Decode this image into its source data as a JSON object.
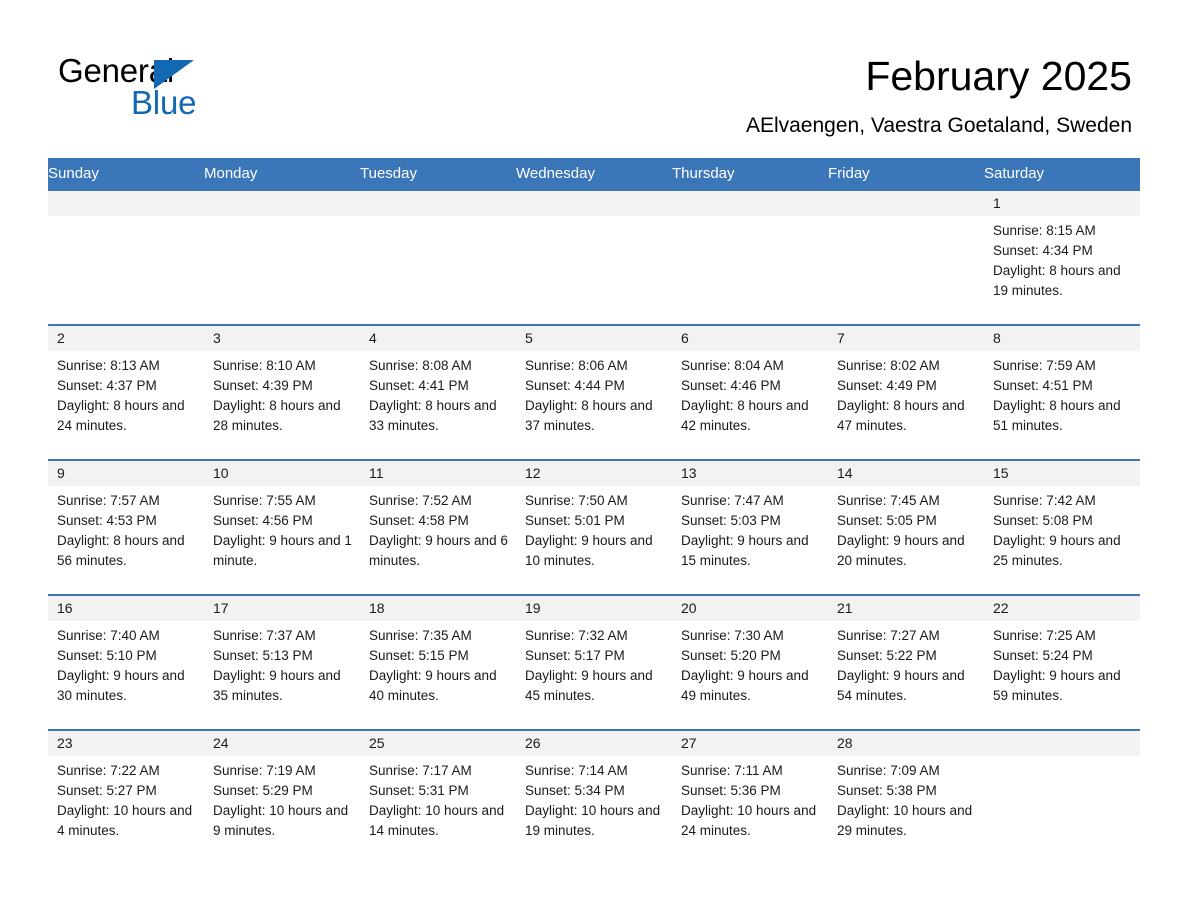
{
  "brand": {
    "name_top": "General",
    "name_bottom": "Blue",
    "accent_color": "#1268b3",
    "triangle_icon": "triangle-icon"
  },
  "header": {
    "title": "February 2025",
    "subtitle": "AElvaengen, Vaestra Goetaland, Sweden"
  },
  "calendar": {
    "header_bg": "#3a76b8",
    "daynum_bg": "#f2f2f2",
    "weekdays": [
      "Sunday",
      "Monday",
      "Tuesday",
      "Wednesday",
      "Thursday",
      "Friday",
      "Saturday"
    ],
    "weeks": [
      [
        {
          "day": "",
          "sunrise": "",
          "sunset": "",
          "daylight": "",
          "empty": true
        },
        {
          "day": "",
          "sunrise": "",
          "sunset": "",
          "daylight": "",
          "empty": true
        },
        {
          "day": "",
          "sunrise": "",
          "sunset": "",
          "daylight": "",
          "empty": true
        },
        {
          "day": "",
          "sunrise": "",
          "sunset": "",
          "daylight": "",
          "empty": true
        },
        {
          "day": "",
          "sunrise": "",
          "sunset": "",
          "daylight": "",
          "empty": true
        },
        {
          "day": "",
          "sunrise": "",
          "sunset": "",
          "daylight": "",
          "empty": true
        },
        {
          "day": "1",
          "sunrise": "Sunrise: 8:15 AM",
          "sunset": "Sunset: 4:34 PM",
          "daylight": "Daylight: 8 hours and 19 minutes.",
          "empty": false
        }
      ],
      [
        {
          "day": "2",
          "sunrise": "Sunrise: 8:13 AM",
          "sunset": "Sunset: 4:37 PM",
          "daylight": "Daylight: 8 hours and 24 minutes.",
          "empty": false
        },
        {
          "day": "3",
          "sunrise": "Sunrise: 8:10 AM",
          "sunset": "Sunset: 4:39 PM",
          "daylight": "Daylight: 8 hours and 28 minutes.",
          "empty": false
        },
        {
          "day": "4",
          "sunrise": "Sunrise: 8:08 AM",
          "sunset": "Sunset: 4:41 PM",
          "daylight": "Daylight: 8 hours and 33 minutes.",
          "empty": false
        },
        {
          "day": "5",
          "sunrise": "Sunrise: 8:06 AM",
          "sunset": "Sunset: 4:44 PM",
          "daylight": "Daylight: 8 hours and 37 minutes.",
          "empty": false
        },
        {
          "day": "6",
          "sunrise": "Sunrise: 8:04 AM",
          "sunset": "Sunset: 4:46 PM",
          "daylight": "Daylight: 8 hours and 42 minutes.",
          "empty": false
        },
        {
          "day": "7",
          "sunrise": "Sunrise: 8:02 AM",
          "sunset": "Sunset: 4:49 PM",
          "daylight": "Daylight: 8 hours and 47 minutes.",
          "empty": false
        },
        {
          "day": "8",
          "sunrise": "Sunrise: 7:59 AM",
          "sunset": "Sunset: 4:51 PM",
          "daylight": "Daylight: 8 hours and 51 minutes.",
          "empty": false
        }
      ],
      [
        {
          "day": "9",
          "sunrise": "Sunrise: 7:57 AM",
          "sunset": "Sunset: 4:53 PM",
          "daylight": "Daylight: 8 hours and 56 minutes.",
          "empty": false
        },
        {
          "day": "10",
          "sunrise": "Sunrise: 7:55 AM",
          "sunset": "Sunset: 4:56 PM",
          "daylight": "Daylight: 9 hours and 1 minute.",
          "empty": false
        },
        {
          "day": "11",
          "sunrise": "Sunrise: 7:52 AM",
          "sunset": "Sunset: 4:58 PM",
          "daylight": "Daylight: 9 hours and 6 minutes.",
          "empty": false
        },
        {
          "day": "12",
          "sunrise": "Sunrise: 7:50 AM",
          "sunset": "Sunset: 5:01 PM",
          "daylight": "Daylight: 9 hours and 10 minutes.",
          "empty": false
        },
        {
          "day": "13",
          "sunrise": "Sunrise: 7:47 AM",
          "sunset": "Sunset: 5:03 PM",
          "daylight": "Daylight: 9 hours and 15 minutes.",
          "empty": false
        },
        {
          "day": "14",
          "sunrise": "Sunrise: 7:45 AM",
          "sunset": "Sunset: 5:05 PM",
          "daylight": "Daylight: 9 hours and 20 minutes.",
          "empty": false
        },
        {
          "day": "15",
          "sunrise": "Sunrise: 7:42 AM",
          "sunset": "Sunset: 5:08 PM",
          "daylight": "Daylight: 9 hours and 25 minutes.",
          "empty": false
        }
      ],
      [
        {
          "day": "16",
          "sunrise": "Sunrise: 7:40 AM",
          "sunset": "Sunset: 5:10 PM",
          "daylight": "Daylight: 9 hours and 30 minutes.",
          "empty": false
        },
        {
          "day": "17",
          "sunrise": "Sunrise: 7:37 AM",
          "sunset": "Sunset: 5:13 PM",
          "daylight": "Daylight: 9 hours and 35 minutes.",
          "empty": false
        },
        {
          "day": "18",
          "sunrise": "Sunrise: 7:35 AM",
          "sunset": "Sunset: 5:15 PM",
          "daylight": "Daylight: 9 hours and 40 minutes.",
          "empty": false
        },
        {
          "day": "19",
          "sunrise": "Sunrise: 7:32 AM",
          "sunset": "Sunset: 5:17 PM",
          "daylight": "Daylight: 9 hours and 45 minutes.",
          "empty": false
        },
        {
          "day": "20",
          "sunrise": "Sunrise: 7:30 AM",
          "sunset": "Sunset: 5:20 PM",
          "daylight": "Daylight: 9 hours and 49 minutes.",
          "empty": false
        },
        {
          "day": "21",
          "sunrise": "Sunrise: 7:27 AM",
          "sunset": "Sunset: 5:22 PM",
          "daylight": "Daylight: 9 hours and 54 minutes.",
          "empty": false
        },
        {
          "day": "22",
          "sunrise": "Sunrise: 7:25 AM",
          "sunset": "Sunset: 5:24 PM",
          "daylight": "Daylight: 9 hours and 59 minutes.",
          "empty": false
        }
      ],
      [
        {
          "day": "23",
          "sunrise": "Sunrise: 7:22 AM",
          "sunset": "Sunset: 5:27 PM",
          "daylight": "Daylight: 10 hours and 4 minutes.",
          "empty": false
        },
        {
          "day": "24",
          "sunrise": "Sunrise: 7:19 AM",
          "sunset": "Sunset: 5:29 PM",
          "daylight": "Daylight: 10 hours and 9 minutes.",
          "empty": false
        },
        {
          "day": "25",
          "sunrise": "Sunrise: 7:17 AM",
          "sunset": "Sunset: 5:31 PM",
          "daylight": "Daylight: 10 hours and 14 minutes.",
          "empty": false
        },
        {
          "day": "26",
          "sunrise": "Sunrise: 7:14 AM",
          "sunset": "Sunset: 5:34 PM",
          "daylight": "Daylight: 10 hours and 19 minutes.",
          "empty": false
        },
        {
          "day": "27",
          "sunrise": "Sunrise: 7:11 AM",
          "sunset": "Sunset: 5:36 PM",
          "daylight": "Daylight: 10 hours and 24 minutes.",
          "empty": false
        },
        {
          "day": "28",
          "sunrise": "Sunrise: 7:09 AM",
          "sunset": "Sunset: 5:38 PM",
          "daylight": "Daylight: 10 hours and 29 minutes.",
          "empty": false
        },
        {
          "day": "",
          "sunrise": "",
          "sunset": "",
          "daylight": "",
          "empty": true
        }
      ]
    ]
  }
}
